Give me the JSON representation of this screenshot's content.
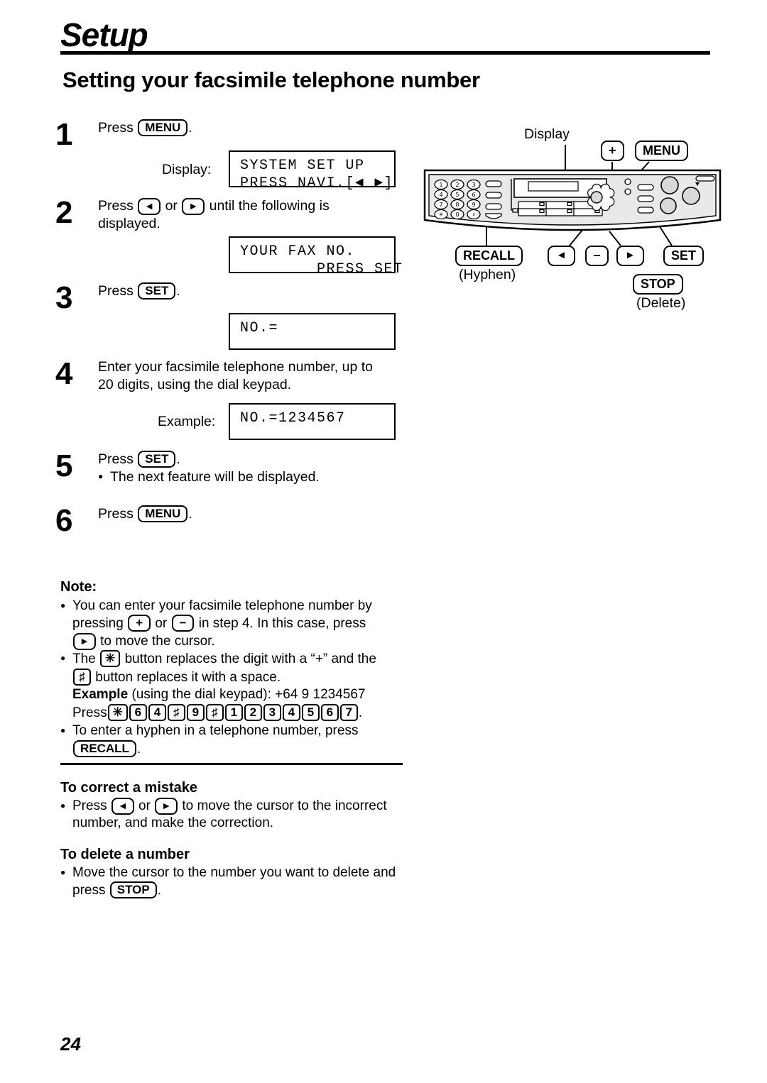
{
  "header": {
    "chapter": "Setup",
    "section_title": "Setting your facsimile telephone number"
  },
  "steps": [
    {
      "num": "1",
      "text_before": "Press",
      "key": "MENU",
      "text_after": ".",
      "display_label": "Display:",
      "lcd": [
        "SYSTEM SET UP",
        "PRESS NAVI.[◄ ►]"
      ]
    },
    {
      "num": "2",
      "text_before": "Press",
      "key_left": "◄",
      "text_or": "or",
      "key_right": "►",
      "text_after": "until the following is",
      "text_line2": "displayed.",
      "lcd": [
        "YOUR FAX NO.",
        "        PRESS SET"
      ]
    },
    {
      "num": "3",
      "text_before": "Press",
      "key": "SET",
      "text_after": ".",
      "lcd": [
        "NO.=",
        ""
      ]
    },
    {
      "num": "4",
      "line1": "Enter your facsimile telephone number, up to",
      "line2": "20 digits, using the dial keypad.",
      "example_label": "Example:",
      "lcd": [
        "NO.=1234567",
        ""
      ]
    },
    {
      "num": "5",
      "text_before": "Press",
      "key": "SET",
      "text_after": ".",
      "bullet": "The next feature will be displayed."
    },
    {
      "num": "6",
      "text_before": "Press",
      "key": "MENU",
      "text_after": "."
    }
  ],
  "note": {
    "heading": "Note:",
    "b1_part1": "You can enter your facsimile telephone number by",
    "b1_part2a": "pressing",
    "b1_key_plus": "+",
    "b1_or": "or",
    "b1_key_minus": "−",
    "b1_part2b": "in step 4. In this case, press",
    "b1_key_right": "►",
    "b1_part3": "to move the cursor.",
    "b2_part1": "The",
    "b2_key_star": "✳",
    "b2_part2": "button replaces the digit with a “+” and the",
    "b2_key_hash": "♯",
    "b2_part3": "button replaces it with a space.",
    "example_bold": "Example",
    "example_rest": "(using the dial keypad):  +64  9  1234567",
    "press_label": "Press",
    "press_keys": [
      "✳",
      "6",
      "4",
      "♯",
      "9",
      "♯",
      "1",
      "2",
      "3",
      "4",
      "5",
      "6",
      "7"
    ],
    "press_period": ".",
    "b3_part1": "To enter a hyphen in a telephone number, press",
    "b3_key_recall": "RECALL",
    "b3_period": "."
  },
  "correct_mistake": {
    "heading": "To correct a mistake",
    "part1": "Press",
    "key_left": "◄",
    "or": "or",
    "key_right": "►",
    "part2": "to move the cursor to the incorrect",
    "line2": "number, and make the correction."
  },
  "delete_number": {
    "heading": "To delete a number",
    "part1": "Move the cursor to the number you want to delete and",
    "part2": "press",
    "key_stop": "STOP",
    "period": "."
  },
  "device": {
    "display_label": "Display",
    "key_plus": "+",
    "key_menu": "MENU",
    "key_recall": "RECALL",
    "recall_sub": "(Hyphen)",
    "key_left": "◄",
    "key_minus": "−",
    "key_right": "►",
    "key_set": "SET",
    "key_stop": "STOP",
    "stop_sub": "(Delete)",
    "keypad": [
      [
        "1",
        "2",
        "3"
      ],
      [
        "4",
        "5",
        "6"
      ],
      [
        "7",
        "8",
        "9"
      ],
      [
        "✳",
        "0",
        "♯"
      ]
    ]
  },
  "page_number": "24"
}
